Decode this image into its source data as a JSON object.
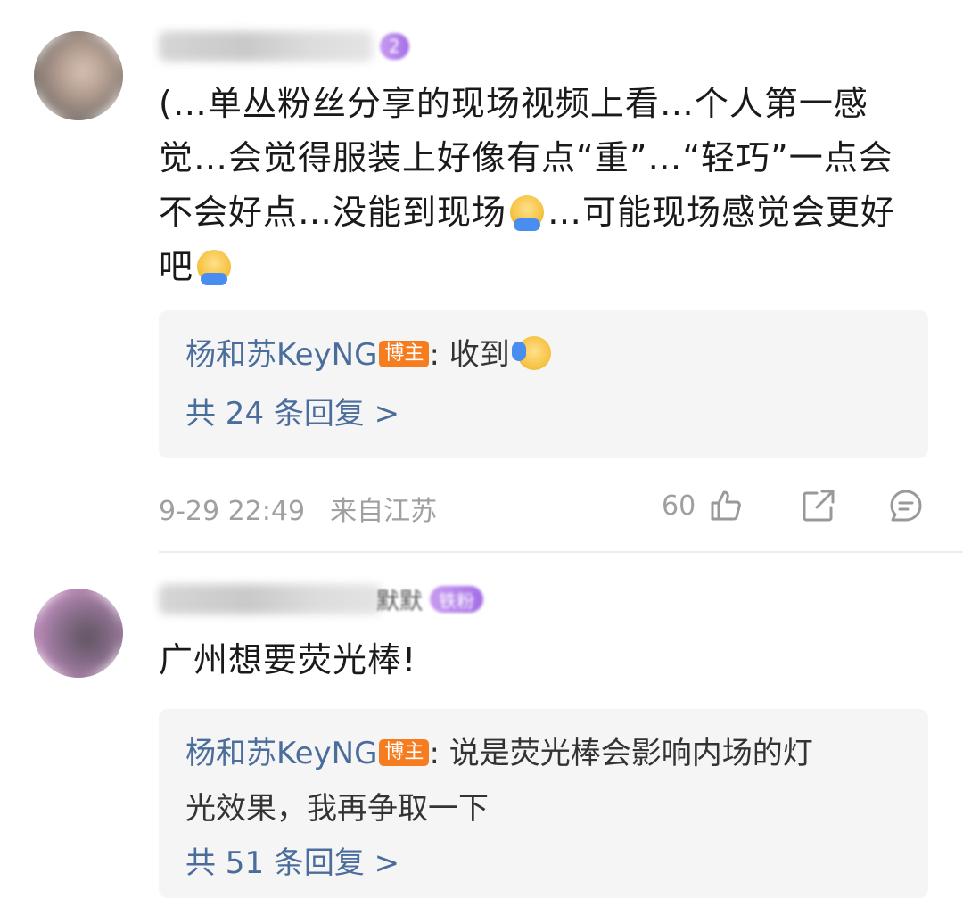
{
  "comments": [
    {
      "fan_level": "2",
      "text_parts": [
        "(…单丛粉丝分享的现场视频上看…个人第一感觉…会觉得服装上好像有点“重”…“轻巧”一点会不会好点…没能到现场",
        "…可能现场感觉会更好吧"
      ],
      "reply": {
        "author": "杨和苏KeyNG",
        "badge": "博主",
        "text": ": 收到"
      },
      "more_replies": "共 24 条回复 >",
      "time": "9-29 22:49",
      "location": "来自江苏",
      "likes": "60"
    },
    {
      "name_tail": "默默",
      "fan_level": "铁粉",
      "text": "广州想要荧光棒!",
      "reply": {
        "author": "杨和苏KeyNG",
        "badge": "博主",
        "text_line1": ": 说是荧光棒会影响内场的灯",
        "text_line2": "光效果，我再争取一下"
      },
      "more_replies": "共 51 条回复 >"
    }
  ]
}
